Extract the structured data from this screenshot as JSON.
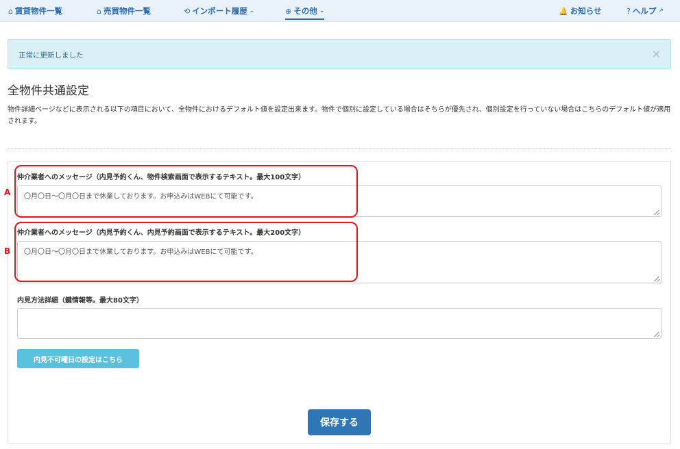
{
  "nav": {
    "items": [
      {
        "icon": "⌂",
        "label": "賃貸物件一覧",
        "chevron": ""
      },
      {
        "icon": "⌂",
        "label": "売買物件一覧",
        "chevron": ""
      },
      {
        "icon": "⟲",
        "label": "インポート履歴",
        "chevron": "⌄"
      },
      {
        "icon": "⊕",
        "label": "その他",
        "chevron": "⌄"
      }
    ],
    "right": [
      {
        "icon": "🔔",
        "label": "お知らせ"
      },
      {
        "icon": "?",
        "label": "ヘルプ",
        "ext": "↗"
      }
    ]
  },
  "alert": {
    "message": "正常に更新しました",
    "close": "×"
  },
  "page": {
    "title": "全物件共通設定",
    "description": "物件詳細ページなどに表示される以下の項目において、全物件におけるデフォルト値を設定出来ます。物件で個別に設定している場合はそちらが優先され、個別設定を行っていない場合はこちらのデフォルト値が適用されます。"
  },
  "fields": {
    "search_msg": {
      "label": "仲介業者へのメッセージ（内見予約くん、物件検索画面で表示するテキスト。最大100文字）",
      "value": "〇月〇日〜〇月〇日まで休業しております。お申込みはWEBにて可能です。"
    },
    "reserve_msg": {
      "label": "仲介業者へのメッセージ（内見予約くん、内見予約画面で表示するテキスト。最大200文字）",
      "value": "〇月〇日〜〇月〇日まで休業しております。お申込みはWEBにて可能です。"
    },
    "method": {
      "label": "内見方法詳細（鍵情報等。最大80文字）",
      "value": ""
    }
  },
  "markers": {
    "a": "A",
    "b": "B"
  },
  "buttons": {
    "unavailable_days": "内見不可曜日の設定はこちら",
    "save": "保存する"
  },
  "colors": {
    "accent": "#2f76b3",
    "highlight": "#e0141e",
    "info": "#5bc0de"
  }
}
